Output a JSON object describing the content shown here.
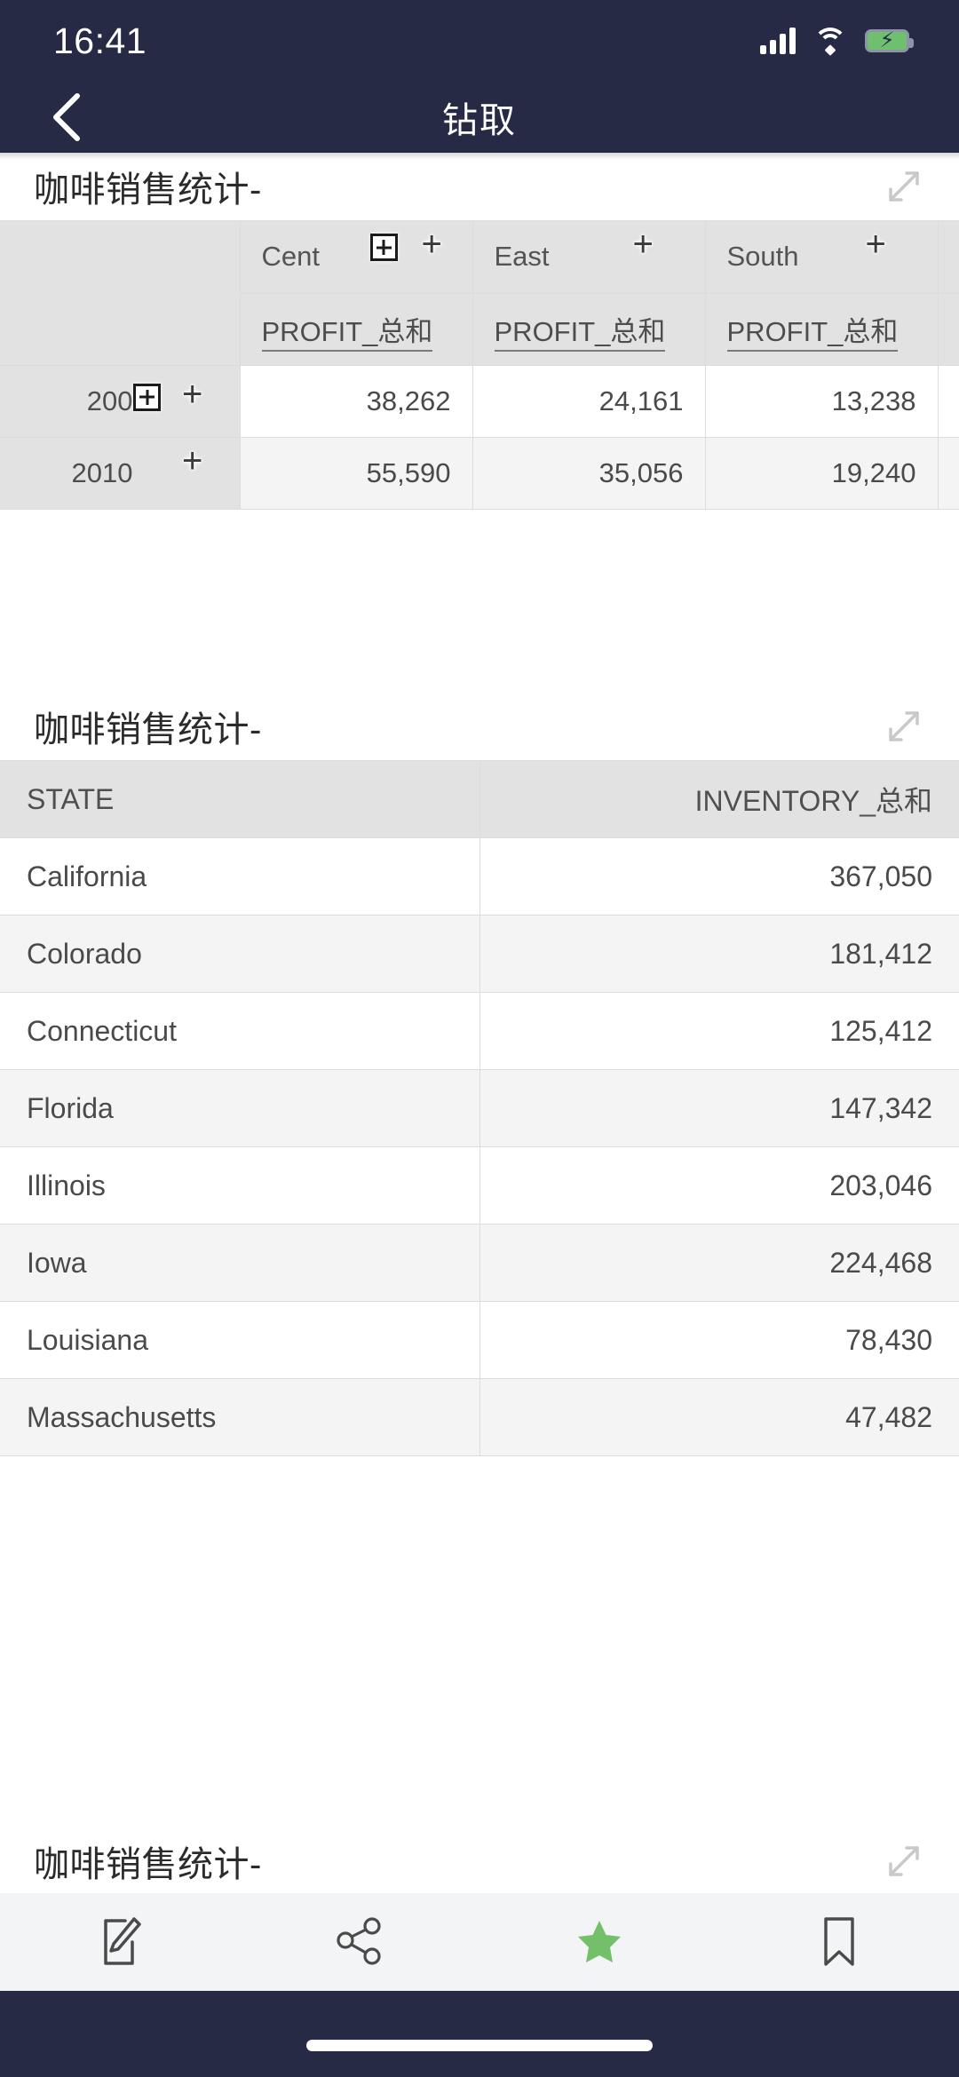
{
  "status": {
    "time": "16:41",
    "signal_icon": "cellular-signal-icon",
    "wifi_icon": "wifi-icon",
    "battery_icon": "battery-charging-icon"
  },
  "nav": {
    "back_icon": "chevron-left-icon",
    "title": "钻取"
  },
  "widget1": {
    "title": "咖啡销售统计-",
    "expand_icon": "expand-arrows-icon",
    "corner_label": "",
    "column_groups": [
      {
        "label": "Cent",
        "drill_icon": "drill-expand-box-icon",
        "plus_icon": "plus-icon"
      },
      {
        "label": "East",
        "plus_icon": "plus-icon"
      },
      {
        "label": "South",
        "plus_icon": "plus-icon"
      }
    ],
    "measures": [
      "PROFIT_总和",
      "PROFIT_总和",
      "PROFIT_总和"
    ],
    "rows": [
      {
        "label": "200",
        "drill_icon": "drill-expand-box-icon",
        "plus_icon": "plus-icon",
        "values": [
          "38,262",
          "24,161",
          "13,238"
        ]
      },
      {
        "label": "2010",
        "plus_icon": "plus-icon",
        "values": [
          "55,590",
          "35,056",
          "19,240"
        ]
      }
    ]
  },
  "widget2": {
    "title": "咖啡销售统计-",
    "expand_icon": "expand-arrows-icon",
    "columns": [
      "STATE",
      "INVENTORY_总和"
    ],
    "rows": [
      {
        "state": "California",
        "inventory": "367,050"
      },
      {
        "state": "Colorado",
        "inventory": "181,412"
      },
      {
        "state": "Connecticut",
        "inventory": "125,412"
      },
      {
        "state": "Florida",
        "inventory": "147,342"
      },
      {
        "state": "Illinois",
        "inventory": "203,046"
      },
      {
        "state": "Iowa",
        "inventory": "224,468"
      },
      {
        "state": "Louisiana",
        "inventory": "78,430"
      },
      {
        "state": "Massachusetts",
        "inventory": "47,482"
      }
    ]
  },
  "widget3": {
    "title": "咖啡销售统计-",
    "expand_icon": "expand-arrows-icon"
  },
  "toolbar": {
    "items": [
      {
        "name": "annotate-icon",
        "label": ""
      },
      {
        "name": "share-icon",
        "label": ""
      },
      {
        "name": "favorite-star-icon",
        "label": ""
      },
      {
        "name": "bookmark-icon",
        "label": ""
      }
    ],
    "active_color": "#74bf6a"
  },
  "colors": {
    "chrome": "#272a45",
    "header_fill": "#e2e2e2",
    "alt_row": "#f4f4f4",
    "accent_green": "#74bf6a"
  }
}
